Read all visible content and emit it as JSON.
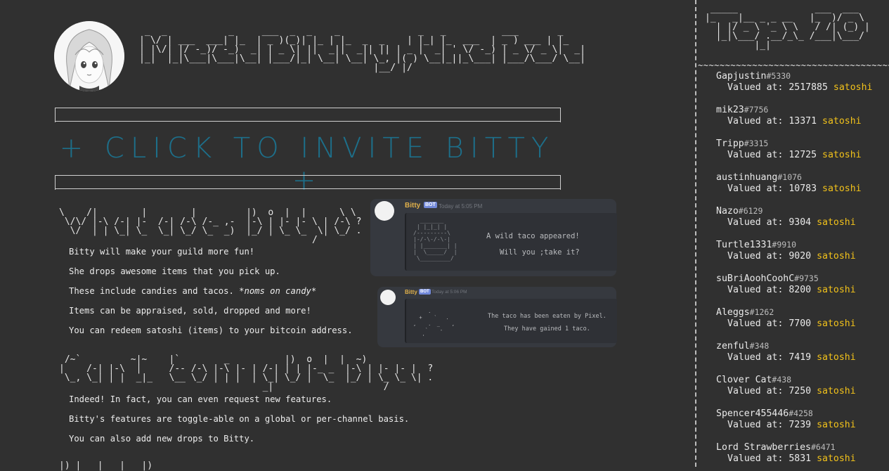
{
  "header": {
    "title_ascii": "  _  _           _     ___  _  _    _              _   _          ___       _   \n | \\/ | ___  ___| |_  | _ )(_)| |_ | |_  _  _    | |_| |_  ___  | _ ) ___ | |_ \n | |\\/| |/ -_)/ -_)  _| | _ \\| ||  _||  _|| || | _ |  _| ' \\/ -_) | _ \\/ _ \\|  _|\n |_|  |_|\\___|\\___|\\__| |___/|_| \\__| \\__| \\_, |( ) \\__|_||_\\___| |___/\\___/ \\__|\n                                           |__/ |/                              ",
    "avatar_icon": "anime-girl-avatar-icon",
    "invite_label": "+ CLICK TO INVITE BITTY +",
    "accent_color": "#1d6f8a"
  },
  "sections": {
    "what": {
      "heading_ascii": "\\    /|        |        |         |)  o  |  |      \\ \\ \n \\/\\/ |-\\ /-| |-  /-| /-\\ /-_ ,-  |-\\ | |- |- \\ | /-\\ ?\n  \\/  | | \\_| \\_  \\_| \\_/ \\_  _)  |_/ | \\_ \\_  \\| \\_/ .\n                                              /        ",
      "lines": [
        "Bitty will make your guild more fun!",
        "She drops awesome items that you pick up.",
        "These include candies and tacos. *noms on candy*",
        "Items can be appraised, sold, dropped and more!",
        "You can redeem satoshi (items) to your bitcoin address."
      ]
    },
    "config": {
      "heading_ascii": " /~`         ~|~    |`        _          |)  o  |  |  ~)\n|    /-| |-\\  |     /-- /-\\ |-\\ |- | /-| | | |-_ _  |-\\ | |- |- |  ?\n \\_, \\_| | |  _|_   \\__ \\_/ | | |  | \\_| \\_/ |  \\_  |_/ | \\_ \\_ \\| .\n                                     _|                    /        ",
      "lines": [
        "Indeed! In fact, you can even request new features.",
        "Bitty's features are toggle-able on a global or per-channel basis.",
        "You can also add new drops to Bitty."
      ]
    },
    "more_heading_ascii": "|) |   |   |   |)"
  },
  "discord": {
    "card1": {
      "bot_name": "Bitty",
      "bot_badge": "BOT",
      "timestamp": "Today at 5:05 PM",
      "message": "A wild taco appeared!\n\n   Will you ;take it?",
      "art_ascii": "  _______\n | |_|_| |\n/---------\\\n|-/-\\-/-\\-|\n| |_______| |\n|  \\_____/  |\n \\_________/"
    },
    "card2": {
      "bot_name": "Bitty",
      "bot_badge": "BOT",
      "timestamp": "Today at 5:06 PM",
      "message": "The taco has been eaten by Pixel.\n\nThey have gained 1 taco.",
      "art_ascii": "     .\n  +    `   .\n,    .  _    ,\n    `    -\n   '"
    }
  },
  "sidebar": {
    "title_ascii": " _____              ___  ___ \n|_   _|__ _ _ __   |_  )/ _ \\\n  | |/ _ \\ '_ \\ \\   / /| (_) |\n  |_|\\___/ .__/_\\_ /___|\\___/ \n         |_|                 ",
    "separator": "~~~~~~~~~~~~~~~~~~~~~~~~~~~~~~~~~~~~~~~~~~~~~~~~",
    "value_label": "Valued at:",
    "unit": "satoshi",
    "unit_color": "#f2c21a",
    "leaders": [
      {
        "name": "Gapjustin",
        "tag": "#5330",
        "value": "2517885"
      },
      {
        "name": "mik23",
        "tag": "#7756",
        "value": "13371"
      },
      {
        "name": "Tripp",
        "tag": "#3315",
        "value": "12725"
      },
      {
        "name": "austinhuang",
        "tag": "#1076",
        "value": "10783"
      },
      {
        "name": "Nazo",
        "tag": "#6129",
        "value": "9304"
      },
      {
        "name": "Turtle1331",
        "tag": "#9910",
        "value": "9020"
      },
      {
        "name": "suBriAoohCoohC",
        "tag": "#9735",
        "value": "8200"
      },
      {
        "name": "Aleggs",
        "tag": "#1262",
        "value": "7700"
      },
      {
        "name": "zenful",
        "tag": "#348",
        "value": "7419"
      },
      {
        "name": "Clover Cat",
        "tag": "#438",
        "value": "7250"
      },
      {
        "name": "Spencer455446",
        "tag": "#4258",
        "value": "7239"
      },
      {
        "name": "Lord Strawberries",
        "tag": "#6471",
        "value": "5831"
      }
    ]
  }
}
